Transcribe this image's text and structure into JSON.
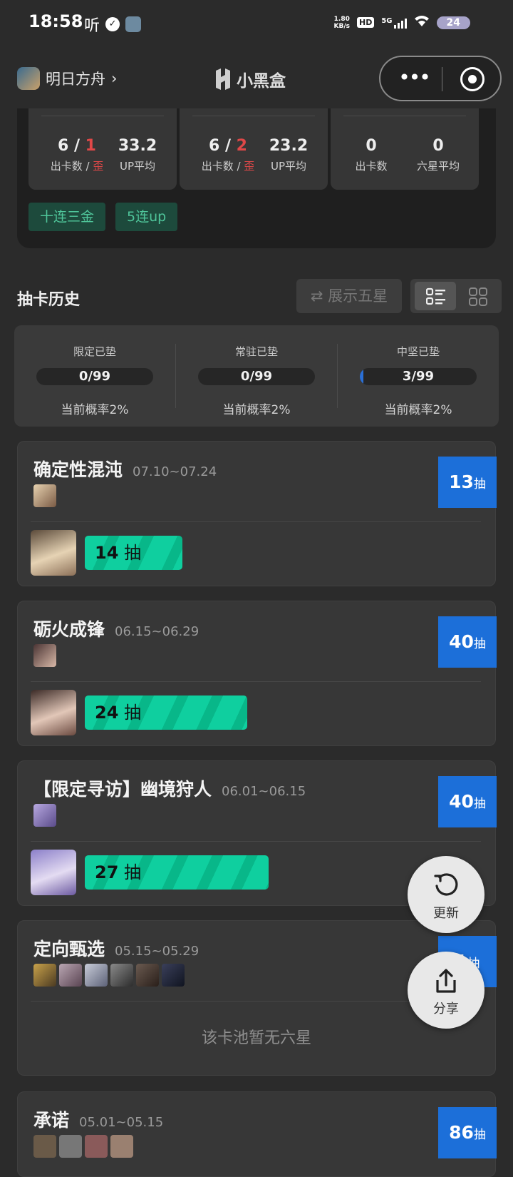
{
  "status_bar": {
    "time": "18:58",
    "listen": "听",
    "net_speed_top": "1.80",
    "net_speed_bottom": "KB/s",
    "hd": "HD",
    "net_type": "5G",
    "battery": "24"
  },
  "nav": {
    "game_name": "明日方舟",
    "brand": "小黑盒",
    "more_glyph": "•••"
  },
  "summary": {
    "cards": [
      {
        "a_pulls": "6",
        "a_off": "1",
        "a_label_main": "出卡数 /",
        "a_label_off": "歪",
        "b_value": "33.2",
        "b_label": "UP平均"
      },
      {
        "a_pulls": "6",
        "a_off": "2",
        "a_label_main": "出卡数 /",
        "a_label_off": "歪",
        "b_value": "23.2",
        "b_label": "UP平均"
      },
      {
        "a_value": "0",
        "a_label": "出卡数",
        "b_value": "0",
        "b_label": "六星平均"
      }
    ],
    "tags": [
      "十连三金",
      "5连up"
    ]
  },
  "history": {
    "title": "抽卡历史",
    "show_five_star": "⇄ 展示五星",
    "view_mode": "list"
  },
  "pity": [
    {
      "label": "限定已垫",
      "value": "0/99",
      "progress": 0.0,
      "rate": "当前概率2%"
    },
    {
      "label": "常驻已垫",
      "value": "0/99",
      "progress": 0.0,
      "rate": "当前概率2%"
    },
    {
      "label": "中坚已垫",
      "value": "3/99",
      "progress": 0.0303,
      "rate": "当前概率2%"
    }
  ],
  "pools": [
    {
      "name": "确定性混沌",
      "dates": "07.10~07.24",
      "count": "13",
      "unit": "抽",
      "record_count": "14",
      "record_unit": "抽",
      "record_fill": 0.18
    },
    {
      "name": "砺火成锋",
      "dates": "06.15~06.29",
      "count": "40",
      "unit": "抽",
      "record_count": "24",
      "record_unit": "抽",
      "record_fill": 0.3
    },
    {
      "name": "【限定寻访】幽境狩人",
      "dates": "06.01~06.15",
      "count": "40",
      "unit": "抽",
      "record_count": "27",
      "record_unit": "抽",
      "record_fill": 0.34
    },
    {
      "name": "定向甄选",
      "dates": "05.15~05.29",
      "count": "1",
      "unit": "抽",
      "empty": "该卡池暂无六星"
    },
    {
      "name": "承诺",
      "dates": "05.01~05.15",
      "count": "86",
      "unit": "抽"
    }
  ],
  "fabs": {
    "refresh": "更新",
    "share": "分享"
  },
  "colors": {
    "accent_blue": "#1c6fd9",
    "record_green": "#0fcf9f",
    "tag_green": "#4fc59a",
    "offbanner_red": "#e04848"
  }
}
